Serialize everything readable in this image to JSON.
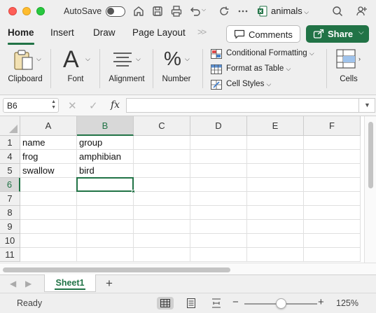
{
  "titlebar": {
    "autosave_label": "AutoSave",
    "doc_title": "animals",
    "icons": [
      "home-icon",
      "save-icon",
      "undo-icon",
      "redo-icon",
      "more-icon",
      "search-icon",
      "share-people-icon"
    ]
  },
  "tabs": [
    {
      "label": "Home",
      "active": true
    },
    {
      "label": "Insert"
    },
    {
      "label": "Draw"
    },
    {
      "label": "Page Layout"
    }
  ],
  "tabs_more": ">>",
  "comments_label": "Comments",
  "share_label": "Share",
  "ribbon": {
    "clipboard": "Clipboard",
    "font": "Font",
    "alignment": "Alignment",
    "number": "Number",
    "conditional_formatting": "Conditional Formatting",
    "format_as_table": "Format as Table",
    "cell_styles": "Cell Styles",
    "cells": "Cells"
  },
  "formula_bar": {
    "name_box": "B6",
    "cancel": "✕",
    "enter": "✓",
    "fx": "fx",
    "formula": ""
  },
  "columns": [
    "A",
    "B",
    "C",
    "D",
    "E",
    "F"
  ],
  "rows": [
    {
      "num": "1",
      "cells": [
        "name",
        "group",
        "",
        "",
        "",
        ""
      ]
    },
    {
      "num": "4",
      "cells": [
        "frog",
        "amphibian",
        "",
        "",
        "",
        ""
      ]
    },
    {
      "num": "5",
      "cells": [
        "swallow",
        "bird",
        "",
        "",
        "",
        ""
      ]
    },
    {
      "num": "6",
      "cells": [
        "",
        "",
        "",
        "",
        "",
        ""
      ]
    },
    {
      "num": "7",
      "cells": [
        "",
        "",
        "",
        "",
        "",
        ""
      ]
    },
    {
      "num": "8",
      "cells": [
        "",
        "",
        "",
        "",
        "",
        ""
      ]
    },
    {
      "num": "9",
      "cells": [
        "",
        "",
        "",
        "",
        "",
        ""
      ]
    },
    {
      "num": "10",
      "cells": [
        "",
        "",
        "",
        "",
        "",
        ""
      ]
    },
    {
      "num": "11",
      "cells": [
        "",
        "",
        "",
        "",
        "",
        ""
      ]
    }
  ],
  "active_cell": "B6",
  "sheets": [
    {
      "label": "Sheet1",
      "active": true
    }
  ],
  "add_sheet": "+",
  "status": {
    "ready": "Ready",
    "zoom": "125%",
    "zoom_minus": "−",
    "zoom_plus": "+",
    "zoom_level": 0.5
  },
  "colors": {
    "accent": "#217346",
    "close": "#fe5f57",
    "minimize": "#febc2e",
    "maximize": "#28c840"
  }
}
